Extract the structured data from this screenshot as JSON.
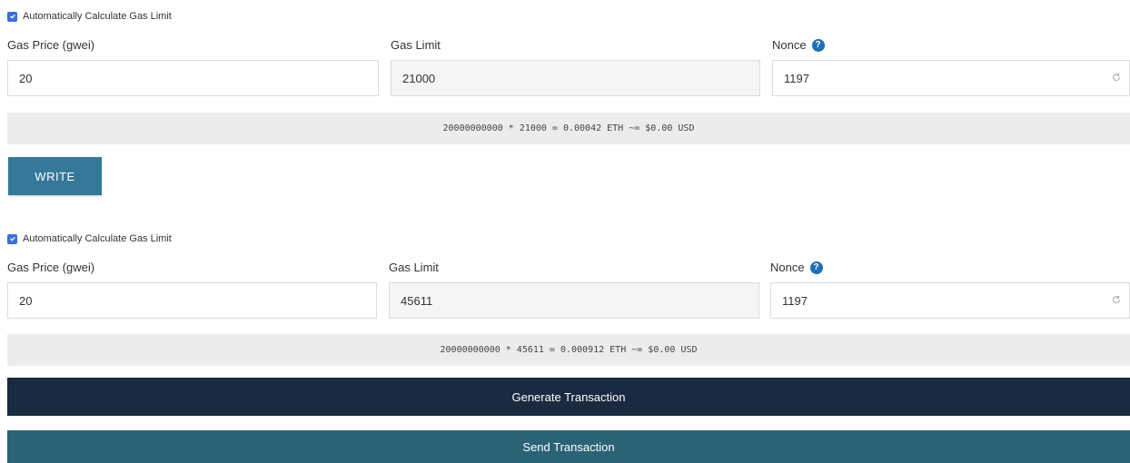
{
  "colors": {
    "checkbox": "#3a6fd8",
    "help_icon": "#1f6fb2",
    "write_button": "#35799a",
    "generate_button": "#1a2a40",
    "send_button": "#2a6376",
    "calc_bar": "#ececec"
  },
  "top": {
    "auto_gas_label": "Automatically Calculate Gas Limit",
    "gas_price_label": "Gas Price (gwei)",
    "gas_price_value": "20",
    "gas_limit_label": "Gas Limit",
    "gas_limit_value": "21000",
    "nonce_label": "Nonce",
    "nonce_value": "1197",
    "calc_text": "20000000000 * 21000 = 0.00042 ETH ~= $0.00 USD",
    "write_label": "WRITE"
  },
  "bottom": {
    "auto_gas_label": "Automatically Calculate Gas Limit",
    "gas_price_label": "Gas Price (gwei)",
    "gas_price_value": "20",
    "gas_limit_label": "Gas Limit",
    "gas_limit_value": "45611",
    "nonce_label": "Nonce",
    "nonce_value": "1197",
    "calc_text": "20000000000 * 45611 = 0.000912 ETH ~= $0.00 USD",
    "generate_label": "Generate Transaction",
    "send_label": "Send Transaction"
  },
  "icons": {
    "help": "question-circle-icon",
    "refresh": "refresh-icon",
    "check": "checkmark-icon"
  }
}
